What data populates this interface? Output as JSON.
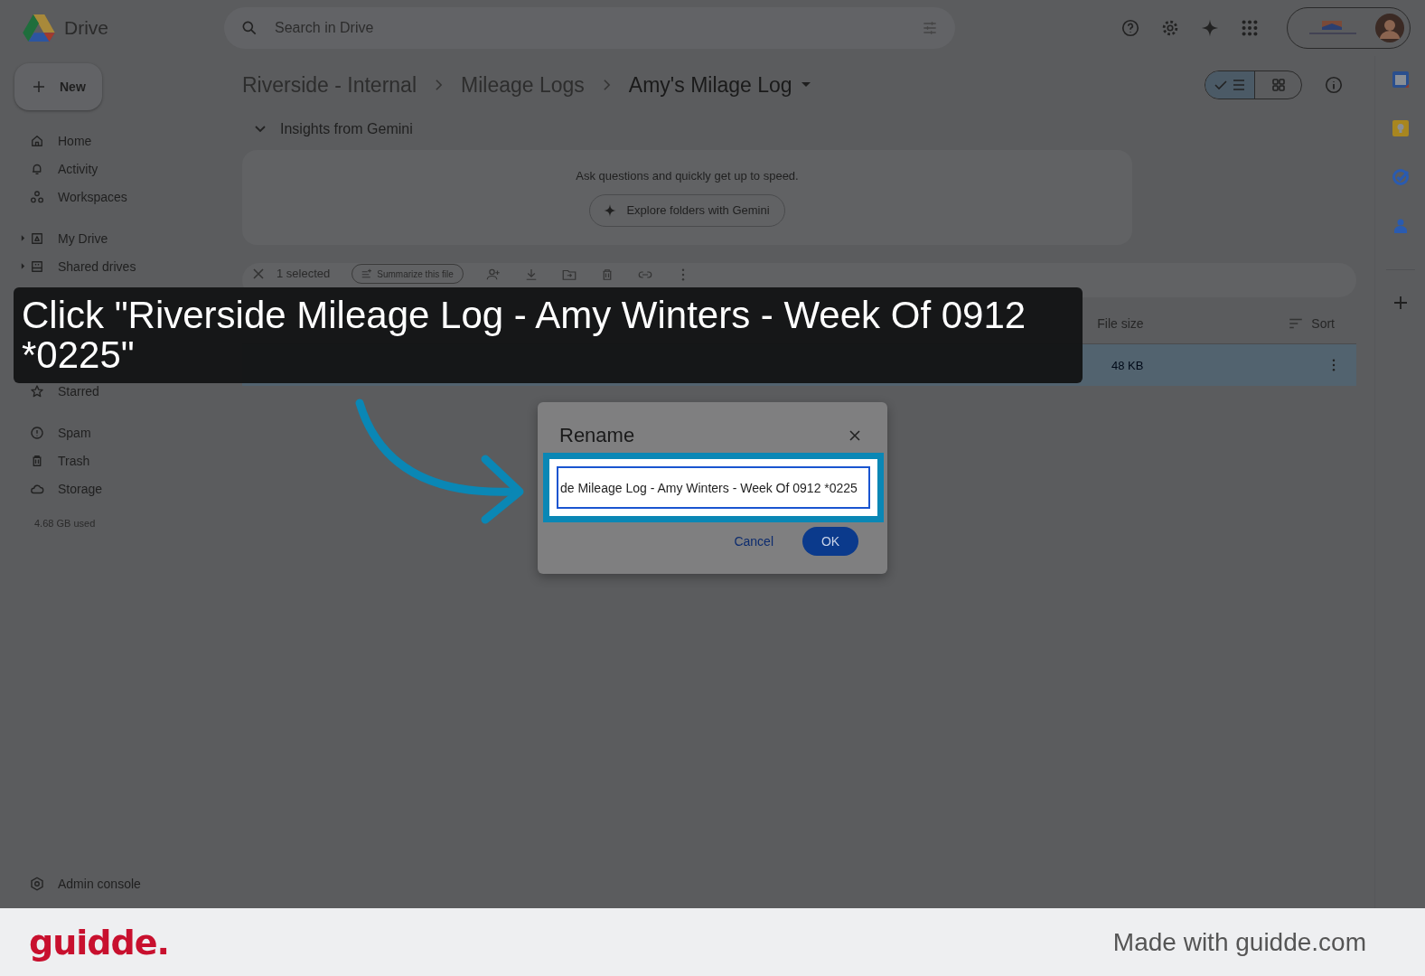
{
  "app": {
    "name": "Drive"
  },
  "search": {
    "placeholder": "Search in Drive"
  },
  "new_button": {
    "label": "New"
  },
  "sidebar": {
    "groups": [
      [
        {
          "label": "Home",
          "expandable": false
        },
        {
          "label": "Activity",
          "expandable": false
        },
        {
          "label": "Workspaces",
          "expandable": false
        }
      ],
      [
        {
          "label": "My Drive",
          "expandable": true
        },
        {
          "label": "Shared drives",
          "expandable": true
        }
      ],
      [
        {
          "label": "Starred",
          "expandable": false
        }
      ],
      [
        {
          "label": "Spam",
          "expandable": false
        },
        {
          "label": "Trash",
          "expandable": false
        },
        {
          "label": "Storage",
          "expandable": false
        }
      ]
    ],
    "storage_used": "4.68 GB used",
    "admin": "Admin console"
  },
  "breadcrumb": [
    {
      "label": "Riverside - Internal",
      "current": false
    },
    {
      "label": "Mileage Logs",
      "current": false
    },
    {
      "label": "Amy's Milage Log",
      "current": true
    }
  ],
  "view_toggle": [
    {
      "kind": "list",
      "selected": true
    },
    {
      "kind": "grid",
      "selected": false
    }
  ],
  "gemini": {
    "title": "Insights from Gemini",
    "expanded": true,
    "prompt": "Ask questions and quickly get up to speed.",
    "button": "Explore folders with Gemini"
  },
  "selection_bar": {
    "count": "1 selected",
    "summarize": "Summarize this file"
  },
  "table": {
    "columns": [
      "File size"
    ],
    "sort": "Sort",
    "rows": [
      {
        "size": "48 KB",
        "selected": true
      }
    ]
  },
  "caption": "Click \"Riverside Mileage Log - Amy Winters - Week Of 0912 *0225\"",
  "dialog": {
    "title": "Rename",
    "value": "de Mileage Log - Amy Winters - Week Of 0912 *0225",
    "buttons": [
      {
        "label": "Cancel",
        "kind": "text"
      },
      {
        "label": "OK",
        "kind": "filled"
      }
    ]
  },
  "footer": {
    "brand": "guidde.",
    "credit": "Made with guidde.com"
  }
}
